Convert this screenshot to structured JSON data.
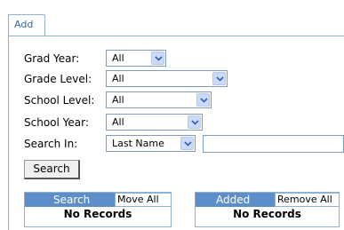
{
  "tabs": [
    {
      "label": "Add"
    }
  ],
  "filters": {
    "grad_year": {
      "label": "Grad Year:",
      "value": "All"
    },
    "grade_level": {
      "label": "Grade Level:",
      "value": "All"
    },
    "school_level": {
      "label": "School Level:",
      "value": "All"
    },
    "school_year": {
      "label": "School Year:",
      "value": "All"
    },
    "search_in": {
      "label": "Search In:",
      "value": "Last Name",
      "text_value": ""
    }
  },
  "search_button": "Search",
  "search_grid": {
    "title": "Search",
    "action": "Move All",
    "empty": "No Records"
  },
  "added_grid": {
    "title": "Added",
    "action": "Remove All",
    "empty": "No Records"
  },
  "colors": {
    "accent": "#5d8ec7",
    "border": "#8fb3d1",
    "tab_text": "#2f6aa3"
  }
}
